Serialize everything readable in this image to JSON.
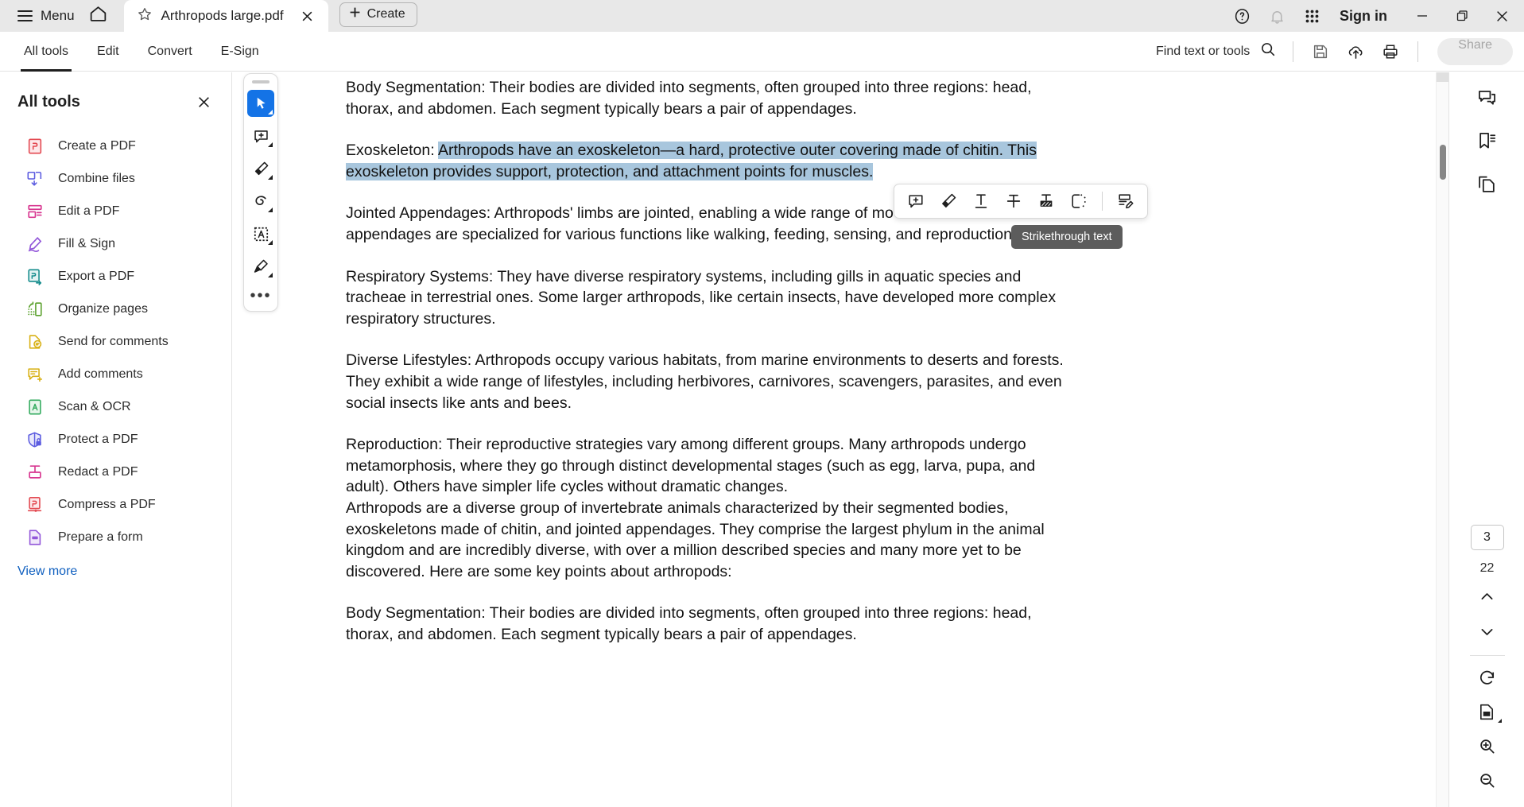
{
  "titlebar": {
    "menu_label": "Menu",
    "home_icon": "home-icon",
    "tab": {
      "title": "Arthropods large.pdf",
      "star_icon": "star-icon",
      "close_icon": "close-icon"
    },
    "create_label": "Create",
    "help_icon": "help-circle-icon",
    "bell_icon": "bell-icon",
    "apps_icon": "app-grid-icon",
    "signin_label": "Sign in",
    "minimize_icon": "minimize-icon",
    "restore_icon": "restore-icon",
    "close_icon": "window-close-icon"
  },
  "commandbar": {
    "tabs": [
      {
        "label": "All tools",
        "active": true
      },
      {
        "label": "Edit",
        "active": false
      },
      {
        "label": "Convert",
        "active": false
      },
      {
        "label": "E-Sign",
        "active": false
      }
    ],
    "find_label": "Find text or tools",
    "search_icon": "search-icon",
    "save_icon": "save-icon",
    "upload_icon": "cloud-upload-icon",
    "print_icon": "print-icon",
    "share_label": "Share"
  },
  "left_panel": {
    "title": "All tools",
    "close_icon": "close-icon",
    "view_more_label": "View more",
    "tools": [
      {
        "label": "Create a PDF",
        "icon": "create-pdf-icon",
        "color": "#e34850"
      },
      {
        "label": "Combine files",
        "icon": "combine-files-icon",
        "color": "#5c5ce0"
      },
      {
        "label": "Edit a PDF",
        "icon": "edit-pdf-icon",
        "color": "#d83790"
      },
      {
        "label": "Fill & Sign",
        "icon": "fill-sign-icon",
        "color": "#9256d9"
      },
      {
        "label": "Export a PDF",
        "icon": "export-pdf-icon",
        "color": "#148c8c"
      },
      {
        "label": "Organize pages",
        "icon": "organize-pages-icon",
        "color": "#5aa02c"
      },
      {
        "label": "Send for comments",
        "icon": "send-comments-icon",
        "color": "#d8b013"
      },
      {
        "label": "Add comments",
        "icon": "add-comments-icon",
        "color": "#d8b013"
      },
      {
        "label": "Scan & OCR",
        "icon": "scan-ocr-icon",
        "color": "#33ab5f"
      },
      {
        "label": "Protect a PDF",
        "icon": "protect-pdf-icon",
        "color": "#5c5ce0"
      },
      {
        "label": "Redact a PDF",
        "icon": "redact-pdf-icon",
        "color": "#d83790"
      },
      {
        "label": "Compress a PDF",
        "icon": "compress-pdf-icon",
        "color": "#e34850"
      },
      {
        "label": "Prepare a form",
        "icon": "prepare-form-icon",
        "color": "#9256d9"
      }
    ]
  },
  "vertical_toolbar": {
    "grip": "drag-grip",
    "buttons": [
      {
        "name": "select-tool",
        "active": true
      },
      {
        "name": "add-comment-tool",
        "active": false
      },
      {
        "name": "highlight-tool",
        "active": false
      },
      {
        "name": "draw-tool",
        "active": false
      },
      {
        "name": "text-box-tool",
        "active": false
      },
      {
        "name": "signature-tool",
        "active": false
      }
    ],
    "more_label": "•••"
  },
  "float_toolbar": {
    "buttons": [
      {
        "name": "add-comment-icon"
      },
      {
        "name": "highlight-text-icon"
      },
      {
        "name": "underline-text-icon"
      },
      {
        "name": "strikethrough-text-icon"
      },
      {
        "name": "redact-text-icon"
      },
      {
        "name": "crop-selection-icon"
      },
      {
        "name": "edit-text-icon"
      }
    ],
    "tooltip": "Strikethrough text"
  },
  "right_rail": {
    "top_icons": [
      {
        "name": "comments-panel-icon"
      },
      {
        "name": "bookmarks-panel-icon"
      },
      {
        "name": "page-thumbnails-icon"
      }
    ],
    "page_current": "3",
    "page_total": "22",
    "prev_icon": "chevron-up-icon",
    "next_icon": "chevron-down-icon",
    "rotate_icon": "rotate-icon",
    "fit_icon": "fit-page-icon",
    "zoom_in_icon": "zoom-in-icon",
    "zoom_out_icon": "zoom-out-icon"
  },
  "document": {
    "paragraphs": [
      {
        "id": "p1",
        "text": "Body Segmentation: Their bodies are divided into segments, often grouped into three regions: head, thorax, and abdomen. Each segment typically bears a pair of appendages."
      },
      {
        "id": "p2_lead",
        "text": "Exoskeleton: "
      },
      {
        "id": "p2_sel",
        "text": "Arthropods have an exoskeleton—a hard, protective outer covering made of chitin. This exoskeleton provides support, protection, and attachment points for muscles."
      },
      {
        "id": "p3",
        "text": "Jointed Appendages: Arthropods' limbs are jointed, enabling a wide range of movement. These appendages are specialized for various functions like walking, feeding, sensing, and reproduction."
      },
      {
        "id": "p4",
        "text": "Respiratory Systems: They have diverse respiratory systems, including gills in aquatic species and tracheae in terrestrial ones. Some larger arthropods, like certain insects, have developed more complex respiratory structures."
      },
      {
        "id": "p5",
        "text": "Diverse Lifestyles: Arthropods occupy various habitats, from marine environments to deserts and forests. They exhibit a wide range of lifestyles, including herbivores, carnivores, scavengers, parasites, and even social insects like ants and bees."
      },
      {
        "id": "p6",
        "text": "Reproduction: Their reproductive strategies vary among different groups. Many arthropods undergo metamorphosis, where they go through distinct developmental stages (such as egg, larva, pupa, and adult). Others have simpler life cycles without dramatic changes."
      },
      {
        "id": "p7",
        "text": "Arthropods are a diverse group of invertebrate animals characterized by their segmented bodies, exoskeletons made of chitin, and jointed appendages. They comprise the largest phylum in the animal kingdom and are incredibly diverse, with over a million described species and many more yet to be discovered. Here are some key points about arthropods:"
      },
      {
        "id": "p8",
        "text": "Body Segmentation: Their bodies are divided into segments, often grouped into three regions: head, thorax, and abdomen. Each segment typically bears a pair of appendages."
      }
    ]
  },
  "colors": {
    "accent_blue": "#1473e6",
    "selection_blue": "#a8c6dd",
    "link_blue": "#0f5fbf",
    "titlebar_bg": "#e8e8e8",
    "tooltip_bg": "#5c5c5c"
  }
}
